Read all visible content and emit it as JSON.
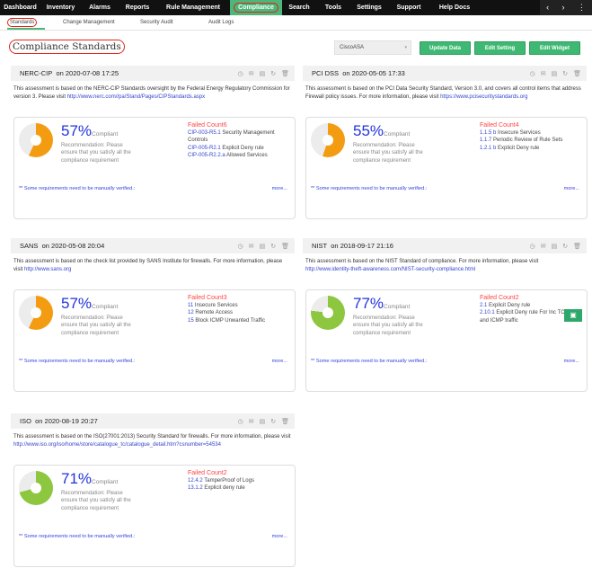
{
  "nav": {
    "items": [
      "Dashboard",
      "Inventory",
      "Alarms",
      "Reports",
      "Rule Management",
      "Compliance",
      "Search",
      "Tools",
      "Settings",
      "Support",
      "Help Docs"
    ],
    "active": "Compliance",
    "prev": "‹",
    "next": "›"
  },
  "subnav": {
    "items": [
      "Standards",
      "Change Management",
      "Security Audit",
      "Audit Logs"
    ],
    "active": "Standards"
  },
  "page": {
    "title": "Compliance Standards",
    "device": "CiscoASA",
    "update": "Update Data",
    "edit_setting": "Edit Setting",
    "edit_widget": "Edit Widget"
  },
  "colors": {
    "accent": "#4cb77a",
    "low": "#f39c12",
    "high": "#8dc63f",
    "fail": "#ff4444",
    "link": "#3344cc"
  },
  "common": {
    "compliant": "Compliant",
    "recommendation": "Recommendation: Please ensure that you satisfy all the compliance requirement",
    "manual": "** Some requirements need to be manually verified.:",
    "more": "more..."
  },
  "widgets": [
    {
      "name": "NERC-CIP",
      "date": "on 2020-07-08 17:25",
      "desc": "This assessment is based on the NERC-CIP Standards oversight by the Federal Energy Regulatory Commission for version 3. Please visit ",
      "link": "http://www.nerc.com//pa/Stand/Pages/CIPStandards.aspx",
      "percent": 57,
      "percent_label": "57%",
      "failed": "Failed Count6",
      "items": [
        {
          "id": "CIP-003-R5.1",
          "text": "Security Management Controls"
        },
        {
          "id": "CIP-005-R2.1",
          "text": "Explicit Deny rule"
        },
        {
          "id": "CIP-005-R2.2.a",
          "text": "Allowed Services"
        }
      ]
    },
    {
      "name": "PCI DSS",
      "date": "on 2020-05-05 17:33",
      "desc": "This assessment is based on the PCI Data Security Standard, Version 3.0, and covers all control items that address Firewall policy issues. For more information, please visit ",
      "link": "https://www.pcisecuritystandards.org",
      "percent": 55,
      "percent_label": "55%",
      "failed": "Failed Count4",
      "items": [
        {
          "id": "1.1.5 b",
          "text": "Insecure Services"
        },
        {
          "id": "1.1.7",
          "text": "Periodic Review of Rule Sets"
        },
        {
          "id": "1.2.1 b",
          "text": "Explicit Deny rule"
        }
      ]
    },
    {
      "name": "SANS",
      "date": "on 2020-05-08 20:04",
      "desc": "This assessment is based on the check list provided by SANS Institute for firewalls. For more information, please visit ",
      "link": "http://www.sans.org",
      "percent": 57,
      "percent_label": "57%",
      "failed": "Failed Count3",
      "items": [
        {
          "id": "11",
          "text": "Insecure Services"
        },
        {
          "id": "12",
          "text": "Remote Access"
        },
        {
          "id": "15",
          "text": "Block ICMP Unwanted Traffic"
        }
      ]
    },
    {
      "name": "NIST",
      "date": "on 2018-09-17 21:16",
      "desc": "This assessment is based on the NIST Standard of compliance. For more information, please visit ",
      "link": "http://www.identity-theft-awareness.com/NIST-security-compliance.html",
      "percent": 77,
      "percent_label": "77%",
      "failed": "Failed Count2",
      "items": [
        {
          "id": "2.1",
          "text": "Explicit Deny rule"
        },
        {
          "id": "2.10.1",
          "text": "Explicit Deny rule For Inc TCP,UDP and ICMP traffic"
        }
      ]
    },
    {
      "name": "ISO",
      "date": "on 2020-08-19 20:27",
      "desc": "This assessment is based on the ISO(27001:2013) Security Standard for firewalls. For more information, please visit ",
      "link": "http://www.iso.org/iso/home/store/catalogue_tc/catalogue_detail.htm?csnumber=54534",
      "percent": 71,
      "percent_label": "71%",
      "failed": "Failed Count2",
      "items": [
        {
          "id": "12.4.2",
          "text": "TamperProof of Logs"
        },
        {
          "id": "13.1.2",
          "text": "Explicit deny rule"
        }
      ]
    }
  ]
}
